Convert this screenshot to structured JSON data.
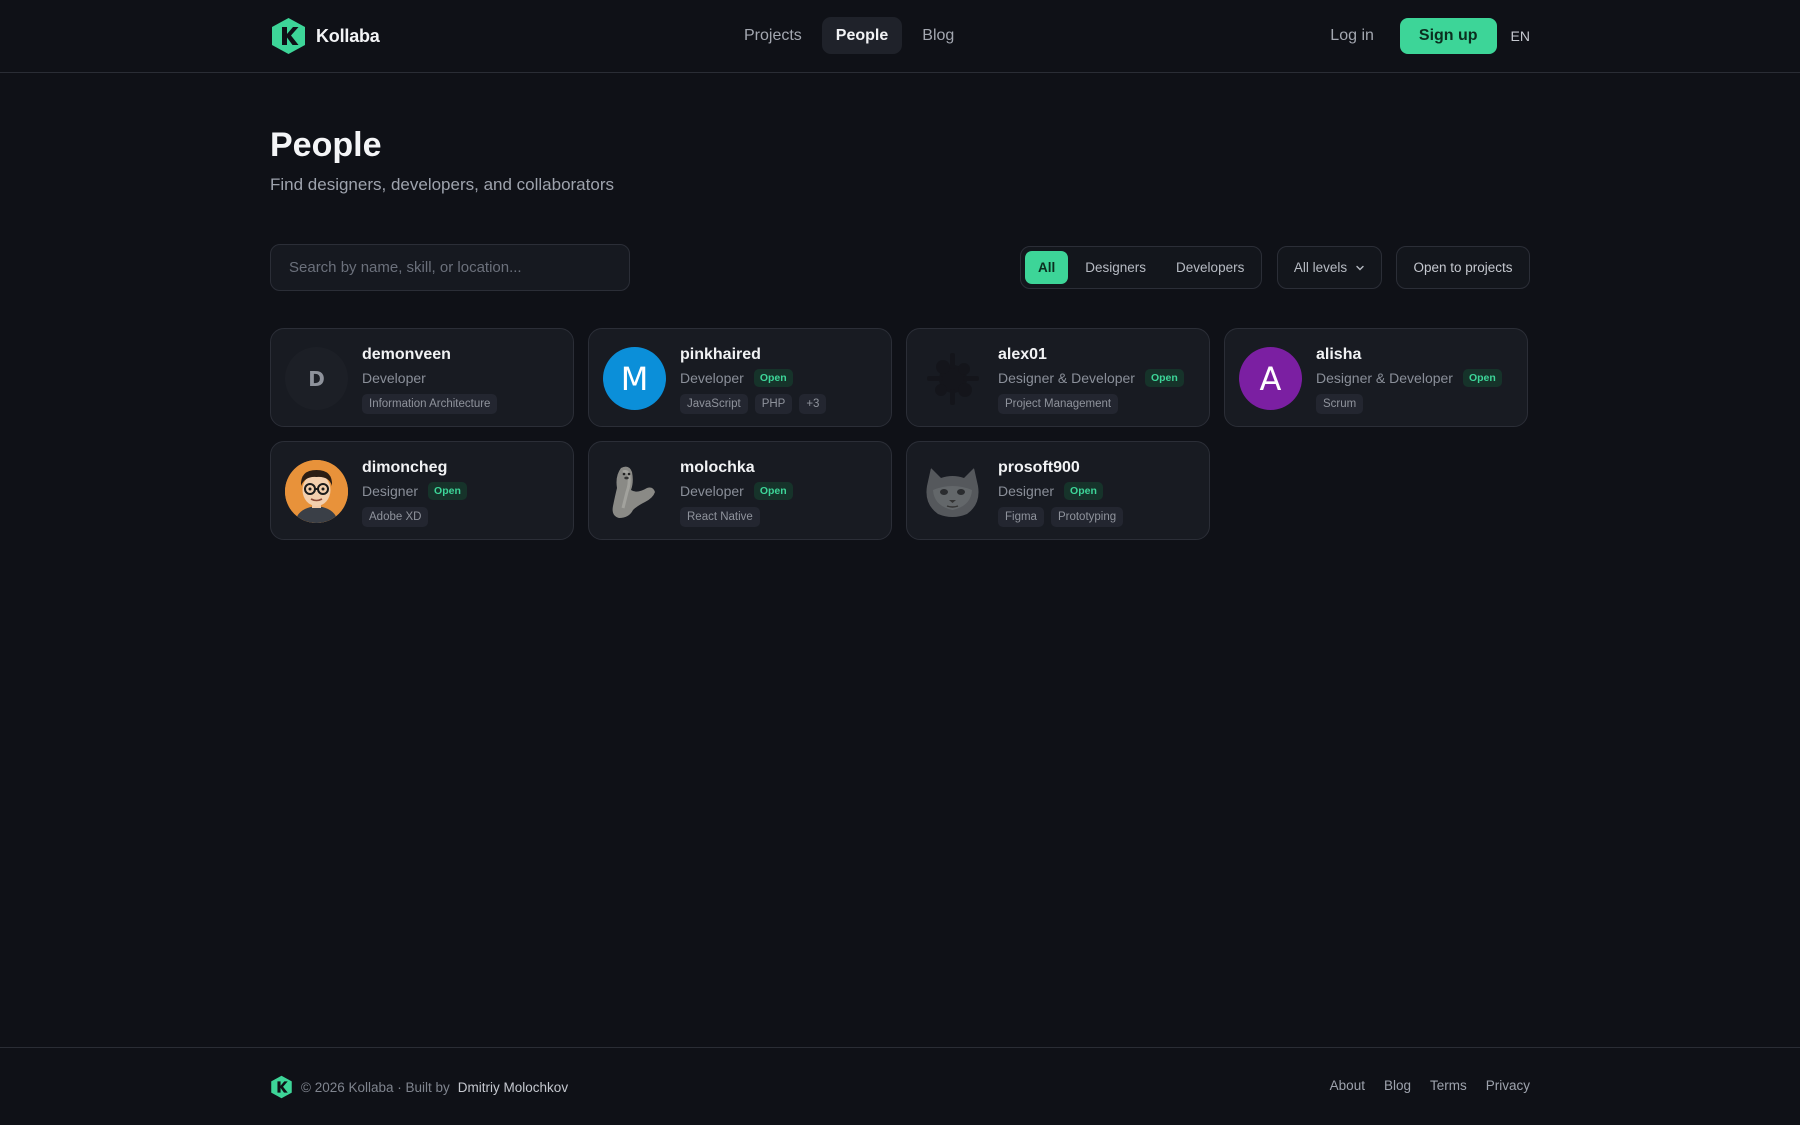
{
  "brand": {
    "name": "Kollaba",
    "color": "#3dd598"
  },
  "nav": [
    {
      "label": "Projects",
      "active": false
    },
    {
      "label": "People",
      "active": true
    },
    {
      "label": "Blog",
      "active": false
    }
  ],
  "auth": {
    "login": "Log in",
    "signup": "Sign up",
    "language": "EN"
  },
  "page": {
    "title": "People",
    "subtitle": "Find designers, developers, and collaborators"
  },
  "search": {
    "placeholder": "Search by name, skill, or location..."
  },
  "filters": {
    "segments": [
      "All",
      "Designers",
      "Developers"
    ],
    "active_segment": "All",
    "level_select": "All levels",
    "open_toggle": "Open to projects"
  },
  "people": [
    {
      "username": "demonveen",
      "role": "Developer",
      "open": false,
      "skills": [
        "Information Architecture"
      ],
      "avatar": {
        "type": "letter",
        "letter": "D",
        "bg": "#1c1f26",
        "muted": true
      }
    },
    {
      "username": "pinkhaired",
      "role": "Developer",
      "open": true,
      "skills": [
        "JavaScript",
        "PHP",
        "+3"
      ],
      "avatar": {
        "type": "letter",
        "letter": "M",
        "bg": "#0b8fd9"
      }
    },
    {
      "username": "alex01",
      "role": "Designer & Developer",
      "open": true,
      "skills": [
        "Project Management"
      ],
      "avatar": {
        "type": "icon",
        "icon": "dark-splash-avatar-icon"
      }
    },
    {
      "username": "alisha",
      "role": "Designer & Developer",
      "open": true,
      "skills": [
        "Scrum"
      ],
      "avatar": {
        "type": "letter",
        "letter": "A",
        "bg": "#7b1fa2"
      }
    },
    {
      "username": "dimoncheg",
      "role": "Designer",
      "open": true,
      "skills": [
        "Adobe XD"
      ],
      "avatar": {
        "type": "icon",
        "icon": "cartoon-man-avatar-icon"
      }
    },
    {
      "username": "molochka",
      "role": "Developer",
      "open": true,
      "skills": [
        "React Native"
      ],
      "avatar": {
        "type": "icon",
        "icon": "seal-avatar-icon"
      }
    },
    {
      "username": "prosoft900",
      "role": "Designer",
      "open": true,
      "skills": [
        "Figma",
        "Prototyping"
      ],
      "avatar": {
        "type": "icon",
        "icon": "cat-avatar-icon"
      }
    }
  ],
  "badge_label": "Open",
  "footer": {
    "copyright": "© 2026 Kollaba · Built by",
    "author": "Dmitriy Molochkov",
    "links": [
      "About",
      "Blog",
      "Terms",
      "Privacy"
    ]
  }
}
